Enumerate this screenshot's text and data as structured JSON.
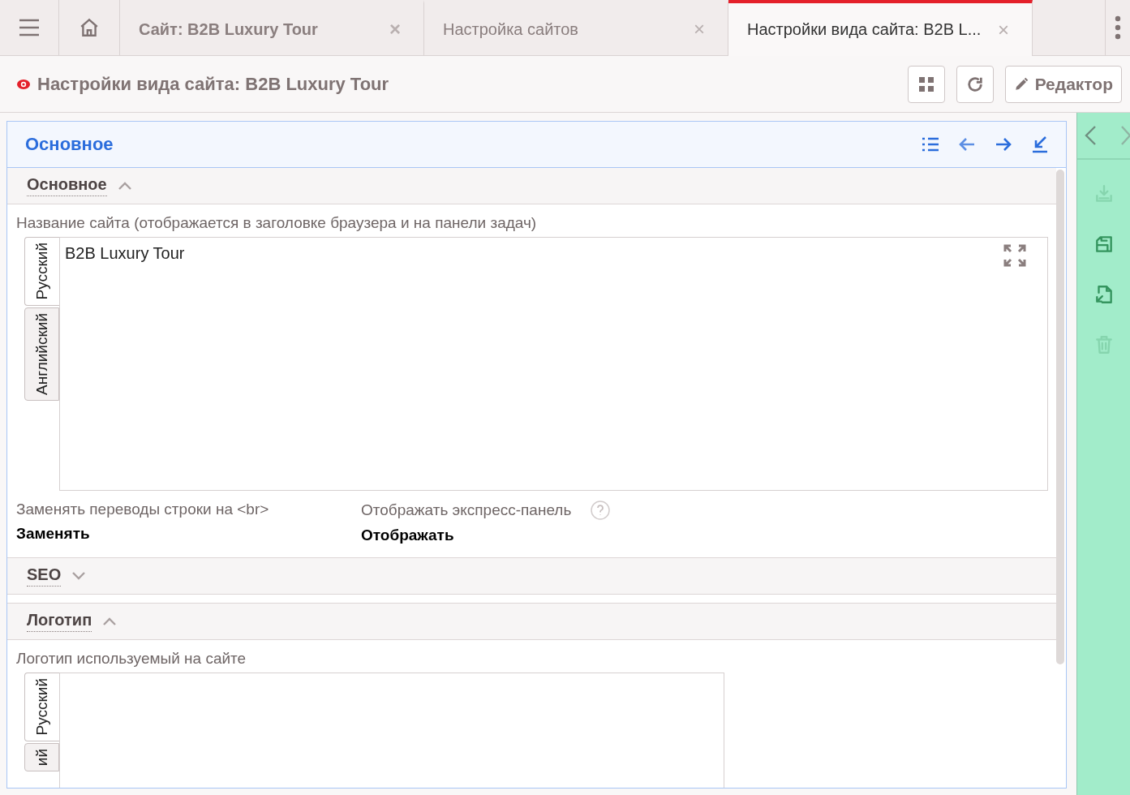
{
  "tabs": [
    {
      "kind": "menu"
    },
    {
      "kind": "home"
    },
    {
      "kind": "doc",
      "label": "Сайт: B2B Luxury Tour",
      "close": "×",
      "selected": false,
      "bold": true
    },
    {
      "kind": "doc",
      "label": "Настройка сайтов",
      "close": "×",
      "selected": false,
      "bold": false
    },
    {
      "kind": "doc",
      "label": "Настройки вида сайта: B2B L...",
      "close": "×",
      "selected": true,
      "bold": false
    }
  ],
  "page_title": "Настройки вида сайта: B2B Luxury Tour",
  "toolbar": {
    "editor_button": "Редактор"
  },
  "panel": {
    "title": "Основное",
    "sections": [
      {
        "title": "Основное",
        "expanded": true,
        "fields": [
          {
            "kind": "multilang",
            "label": "Название сайта (отображается в заголовке браузера и на панели задач)",
            "value": "B2B Luxury Tour",
            "lang_tabs": [
              {
                "label": "Русский",
                "selected": true
              },
              {
                "label": "Английский",
                "selected": false
              }
            ]
          },
          {
            "kind": "pair",
            "items": [
              {
                "label": "Заменять переводы строки на <br>",
                "value": "Заменять",
                "help": false
              },
              {
                "label": "Отображать экспресс-панель",
                "value": "Отображать",
                "help": true
              }
            ]
          }
        ]
      },
      {
        "title": "SEO",
        "expanded": false
      },
      {
        "title": "Логотип",
        "expanded": true,
        "fields": [
          {
            "kind": "image",
            "label": "Логотип используемый на сайте",
            "lang_tabs": [
              {
                "label": "Русский",
                "selected": true
              },
              {
                "label": "ий",
                "selected": false
              }
            ]
          }
        ]
      }
    ]
  },
  "sidebar_actions": [
    {
      "disabled": true
    },
    {
      "disabled": false
    },
    {
      "disabled": false
    },
    {
      "disabled": true
    }
  ]
}
